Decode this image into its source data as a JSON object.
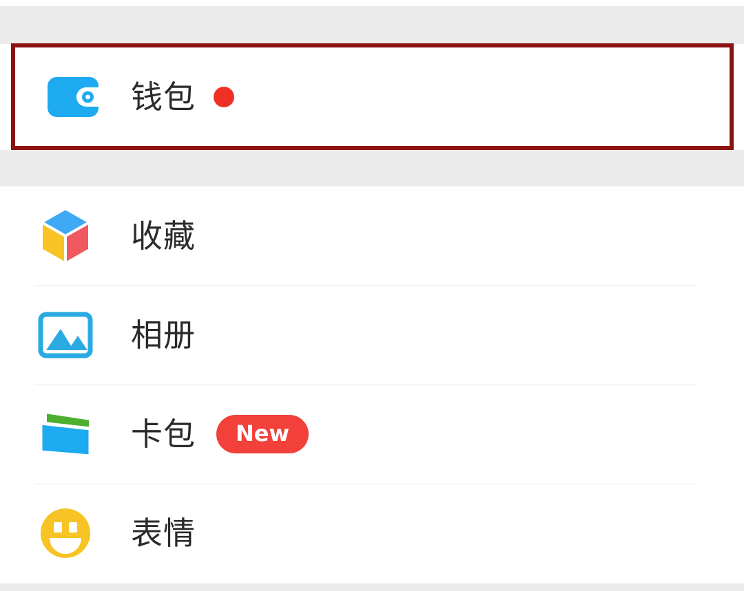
{
  "app": {
    "screen_name": "微信我的页面",
    "background_color": "#ffffff",
    "gap_color": "#ebebeb"
  },
  "annotation": {
    "type": "highlight-box",
    "color": "#8c1212",
    "target": "钱包",
    "border_width_px": 6
  },
  "highlighted_section": {
    "row": {
      "icon": "wallet-icon",
      "icon_colors": {
        "primary": "#1eaaf1",
        "cutout": "#ffffff"
      },
      "label": "钱包",
      "badge": {
        "type": "dot",
        "color": "#ee3124",
        "name": "red-dot-badge"
      }
    }
  },
  "list": {
    "rows": [
      {
        "icon": "favorites-cube-icon",
        "icon_colors": {
          "top": "#3fa9f5",
          "left": "#f7c325",
          "right": "#f1585f"
        },
        "label": "收藏",
        "badge": null
      },
      {
        "icon": "photo-album-icon",
        "icon_colors": {
          "primary": "#29abe2"
        },
        "label": "相册",
        "badge": null
      },
      {
        "icon": "card-package-icon",
        "icon_colors": {
          "front": "#1eaaf1",
          "back": "#4caf2e"
        },
        "label": "卡包",
        "badge": {
          "type": "pill",
          "text": "New",
          "color": "#f2403a",
          "text_color": "#ffffff",
          "name": "new-badge"
        }
      },
      {
        "icon": "emoji-smiley-icon",
        "icon_colors": {
          "primary": "#f7c325"
        },
        "label": "表情",
        "badge": null
      }
    ]
  }
}
